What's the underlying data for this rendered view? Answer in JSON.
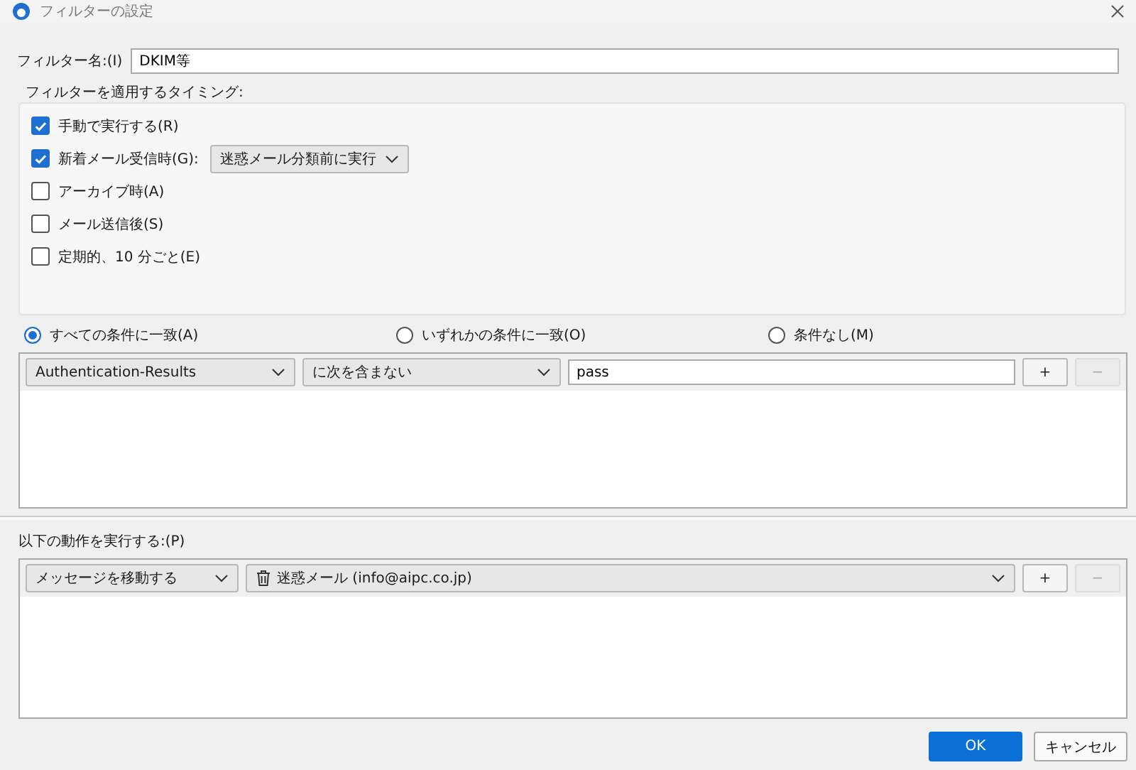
{
  "window": {
    "title": "フィルターの設定"
  },
  "filter_name": {
    "label": "フィルター名:(I)",
    "value": "DKIM等"
  },
  "timing": {
    "label": "フィルターを適用するタイミング:",
    "items": [
      {
        "kind": "checkbox",
        "label": "手動で実行する(R)",
        "checked": true
      },
      {
        "kind": "checkbox_select",
        "label": "新着メール受信時(G):",
        "checked": true,
        "select": "迷惑メール分類前に実行"
      },
      {
        "kind": "checkbox",
        "label": "アーカイブ時(A)",
        "checked": false
      },
      {
        "kind": "checkbox",
        "label": "メール送信後(S)",
        "checked": false
      },
      {
        "kind": "checkbox",
        "label": "定期的、10 分ごと(E)",
        "checked": false
      }
    ]
  },
  "match": [
    {
      "label": "すべての条件に一致(A)",
      "selected": true
    },
    {
      "label": "いずれかの条件に一致(O)",
      "selected": false
    },
    {
      "label": "条件なし(M)",
      "selected": false
    }
  ],
  "conditions": [
    {
      "field": "Authentication-Results",
      "operator": "に次を含まない",
      "value": "pass",
      "add": "+",
      "remove": "−",
      "remove_disabled": true
    }
  ],
  "actions_label": "以下の動作を実行する:(P)",
  "actions": [
    {
      "action": "メッセージを移動する",
      "target": "迷惑メール (info@aipc.co.jp)",
      "add": "+",
      "remove": "−",
      "remove_disabled": true
    }
  ],
  "buttons": [
    {
      "label": "OK",
      "primary": true
    },
    {
      "label": "キャンセル",
      "primary": false
    }
  ]
}
